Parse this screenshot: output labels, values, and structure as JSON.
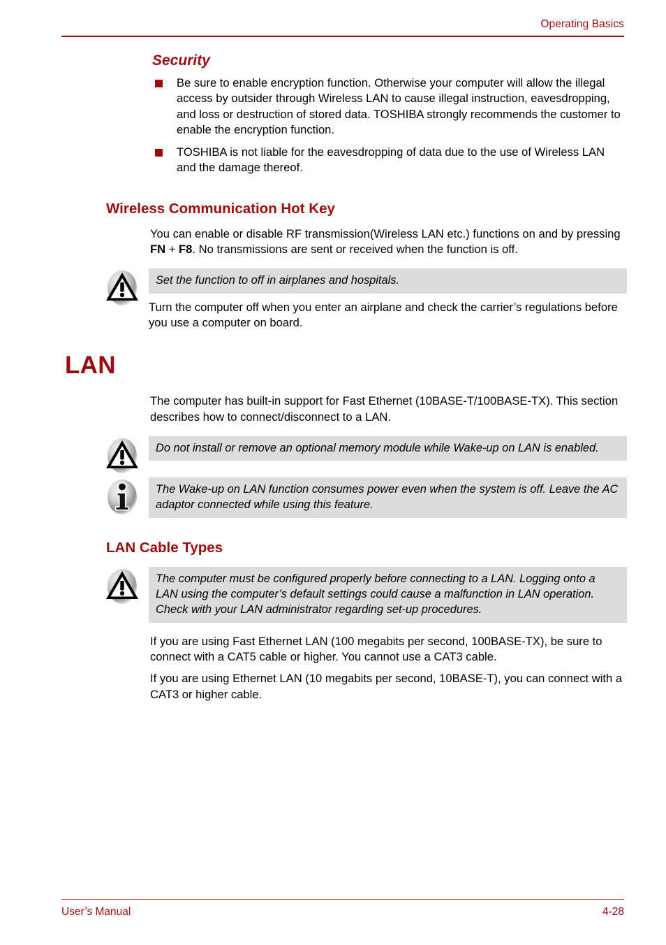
{
  "header": {
    "title": "Operating Basics"
  },
  "footer": {
    "manual_label": "User’s Manual",
    "page_number": "4-28"
  },
  "colors": {
    "accent_red": "#9E0B0E",
    "note_background": "#DCDCDC",
    "text": "#000000",
    "page_background": "#FFFFFF"
  },
  "sections": {
    "security": {
      "heading": "Security",
      "bullets": [
        "Be sure to enable encryption function. Otherwise your computer will allow the illegal access by outsider through Wireless LAN to cause illegal instruction, eavesdropping, and loss or destruction of stored data. TOSHIBA strongly recommends the customer to enable the encryption function.",
        "TOSHIBA is not liable for the eavesdropping of data due to the use of Wireless LAN and the damage thereof."
      ]
    },
    "hotkey": {
      "heading": "Wireless Communication Hot Key",
      "paragraph_part1": "You can enable or disable RF transmission(Wireless LAN etc.) functions on and by pressing ",
      "key1": "FN",
      "key_plus": " + ",
      "key2": "F8",
      "paragraph_part2": ". No transmissions are sent or received when the function is off.",
      "caution": {
        "icon": "caution-triangle-icon",
        "text": "Set the function to off in airplanes and hospitals."
      },
      "after_caution": "Turn the computer off when you enter an airplane and check the carrier’s regulations before you use a computer on board."
    },
    "lan": {
      "heading": "LAN",
      "intro": "The computer has built-in support for Fast Ethernet (10BASE-T/100BASE-TX). This section describes how to connect/disconnect to a LAN.",
      "caution": {
        "icon": "caution-triangle-icon",
        "text": "Do not install or remove an optional memory module while Wake-up on LAN is enabled."
      },
      "info": {
        "icon": "info-i-icon",
        "text": "The Wake-up on LAN function consumes power even when the system is off. Leave the AC adaptor connected while using this feature."
      }
    },
    "lan_cable_types": {
      "heading": "LAN Cable Types",
      "caution": {
        "icon": "caution-triangle-icon",
        "text": "The computer must be configured properly before connecting to a LAN. Logging onto a LAN using the computer’s default settings could cause a malfunction in LAN operation. Check with your LAN administrator regarding set-up procedures."
      },
      "paragraphs": [
        "If you are using Fast Ethernet LAN (100 megabits per second, 100BASE-TX), be sure to connect with a CAT5 cable or higher. You cannot use a CAT3 cable.",
        "If you are using Ethernet LAN (10 megabits per second, 10BASE-T), you can connect with a CAT3 or higher cable."
      ]
    }
  }
}
